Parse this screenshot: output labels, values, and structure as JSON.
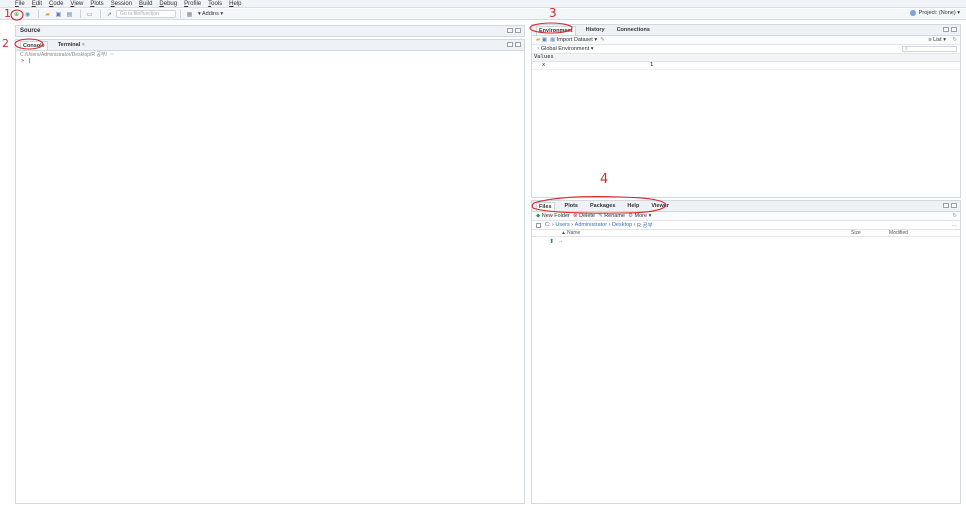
{
  "menu": [
    "File",
    "Edit",
    "Code",
    "View",
    "Plots",
    "Session",
    "Build",
    "Debug",
    "Profile",
    "Tools",
    "Help"
  ],
  "toolbar": {
    "goto_placeholder": "Go to file/function",
    "addins_label": "Addins"
  },
  "project": {
    "label": "Project: (None)"
  },
  "source_pane": {
    "title": "Source"
  },
  "console_pane": {
    "tabs": [
      "Console",
      "Terminal"
    ],
    "path": "C:/Users/Administrator/Desktop/R 공부/",
    "prompt": ">"
  },
  "env_pane": {
    "tabs": [
      "Environment",
      "History",
      "Connections"
    ],
    "import_label": "Import Dataset",
    "list_label": "List",
    "scope_label": "Global Environment",
    "section_label": "Values",
    "values": [
      {
        "name": "x",
        "value": "1"
      }
    ]
  },
  "files_pane": {
    "tabs": [
      "Files",
      "Plots",
      "Packages",
      "Help",
      "Viewer"
    ],
    "actions": {
      "new_folder": "New Folder",
      "delete": "Delete",
      "rename": "Rename",
      "more": "More"
    },
    "breadcrumb": [
      "C:",
      "Users",
      "Administrator",
      "Desktop",
      "R 공부"
    ],
    "columns": {
      "name": "Name",
      "size": "Size",
      "modified": "Modified"
    },
    "rows": [
      {
        "name": ".."
      }
    ]
  },
  "annotations": [
    "1",
    "2",
    "3",
    "4"
  ],
  "colors": {
    "annotation": "#d52a2a",
    "header_bg": "#eef1f6",
    "link": "#3b6fb6"
  }
}
